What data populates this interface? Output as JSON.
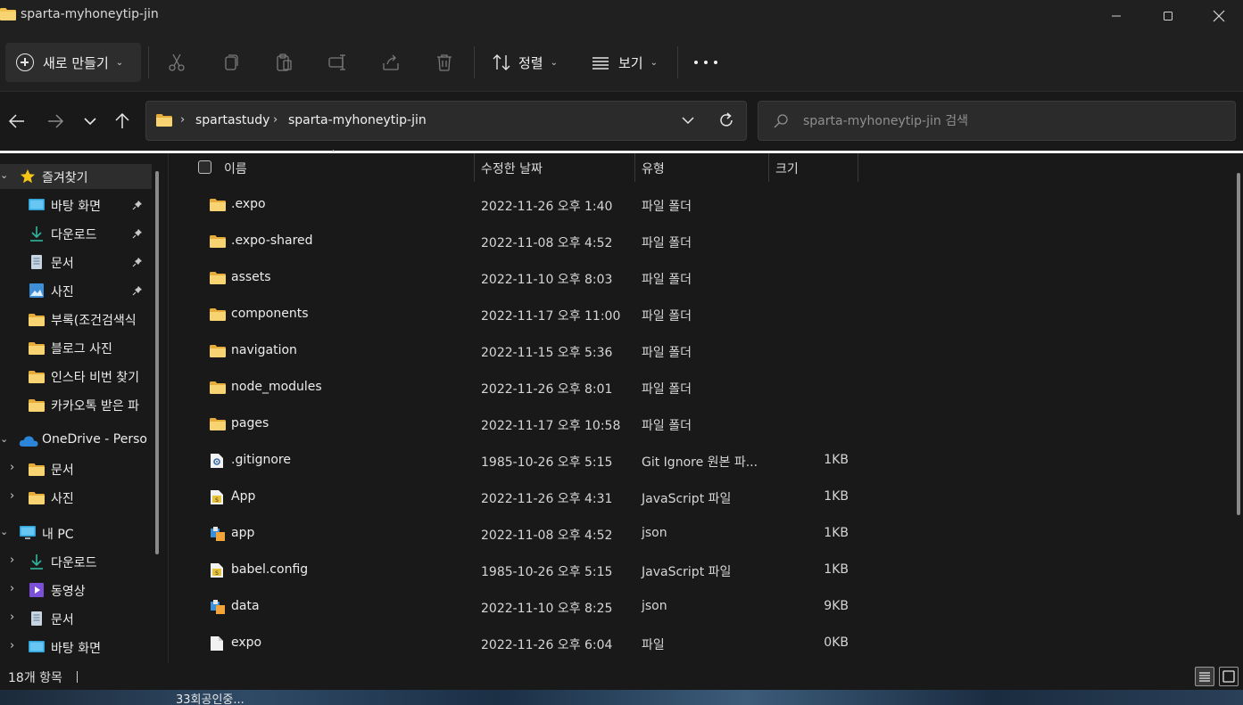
{
  "window": {
    "title": "sparta-myhoneytip-jin"
  },
  "toolbar": {
    "new_label": "새로 만들기",
    "sort_label": "정렬",
    "view_label": "보기"
  },
  "address": {
    "breadcrumbs": [
      "spartastudy",
      "sparta-myhoneytip-jin"
    ],
    "search_placeholder": "sparta-myhoneytip-jin 검색"
  },
  "sidebar": {
    "quick_access": "즐겨찾기",
    "quick_items": [
      {
        "label": "바탕 화면",
        "icon": "desktop-icon",
        "pinned": true
      },
      {
        "label": "다운로드",
        "icon": "download-icon",
        "pinned": true
      },
      {
        "label": "문서",
        "icon": "document-icon",
        "pinned": true
      },
      {
        "label": "사진",
        "icon": "pictures-icon",
        "pinned": true
      },
      {
        "label": "부록(조건검색식",
        "icon": "folder-icon",
        "pinned": false
      },
      {
        "label": "블로그 사진",
        "icon": "folder-icon",
        "pinned": false
      },
      {
        "label": "인스타 비번 찾기",
        "icon": "folder-icon",
        "pinned": false
      },
      {
        "label": "카카오톡 받은 파",
        "icon": "folder-icon",
        "pinned": false
      }
    ],
    "onedrive": "OneDrive - Perso",
    "onedrive_items": [
      {
        "label": "문서",
        "icon": "folder-icon"
      },
      {
        "label": "사진",
        "icon": "folder-icon"
      }
    ],
    "pc": "내 PC",
    "pc_items": [
      {
        "label": "다운로드",
        "icon": "download-icon"
      },
      {
        "label": "동영상",
        "icon": "video-icon"
      },
      {
        "label": "문서",
        "icon": "document-icon"
      },
      {
        "label": "바탕 화면",
        "icon": "desktop-icon"
      }
    ]
  },
  "columns": {
    "name": "이름",
    "modified": "수정한 날짜",
    "type": "유형",
    "size": "크기"
  },
  "files": [
    {
      "name": ".expo",
      "modified": "2022-11-26 오후 1:40",
      "type": "파일 폴더",
      "size": "",
      "icon": "folder-icon"
    },
    {
      "name": ".expo-shared",
      "modified": "2022-11-08 오후 4:52",
      "type": "파일 폴더",
      "size": "",
      "icon": "folder-icon"
    },
    {
      "name": "assets",
      "modified": "2022-11-10 오후 8:03",
      "type": "파일 폴더",
      "size": "",
      "icon": "folder-icon"
    },
    {
      "name": "components",
      "modified": "2022-11-17 오후 11:00",
      "type": "파일 폴더",
      "size": "",
      "icon": "folder-icon"
    },
    {
      "name": "navigation",
      "modified": "2022-11-15 오후 5:36",
      "type": "파일 폴더",
      "size": "",
      "icon": "folder-icon"
    },
    {
      "name": "node_modules",
      "modified": "2022-11-26 오후 8:01",
      "type": "파일 폴더",
      "size": "",
      "icon": "folder-icon"
    },
    {
      "name": "pages",
      "modified": "2022-11-17 오후 10:58",
      "type": "파일 폴더",
      "size": "",
      "icon": "folder-icon"
    },
    {
      "name": ".gitignore",
      "modified": "1985-10-26 오후 5:15",
      "type": "Git Ignore 원본 파...",
      "size": "1KB",
      "icon": "gear-file-icon"
    },
    {
      "name": "App",
      "modified": "2022-11-26 오후 4:31",
      "type": "JavaScript 파일",
      "size": "1KB",
      "icon": "js-file-icon"
    },
    {
      "name": "app",
      "modified": "2022-11-08 오후 4:52",
      "type": "json",
      "size": "1KB",
      "icon": "json-file-icon"
    },
    {
      "name": "babel.config",
      "modified": "1985-10-26 오후 5:15",
      "type": "JavaScript 파일",
      "size": "1KB",
      "icon": "js-file-icon"
    },
    {
      "name": "data",
      "modified": "2022-11-10 오후 8:25",
      "type": "json",
      "size": "9KB",
      "icon": "json-file-icon"
    },
    {
      "name": "expo",
      "modified": "2022-11-26 오후 6:04",
      "type": "파일",
      "size": "0KB",
      "icon": "blank-file-icon"
    }
  ],
  "status": {
    "item_count": "18개 항목"
  },
  "desktop": {
    "label": "33회공인중..."
  },
  "colors": {
    "folder": "#f2c14e",
    "background": "#191919",
    "accent": "#4fa3e0"
  }
}
